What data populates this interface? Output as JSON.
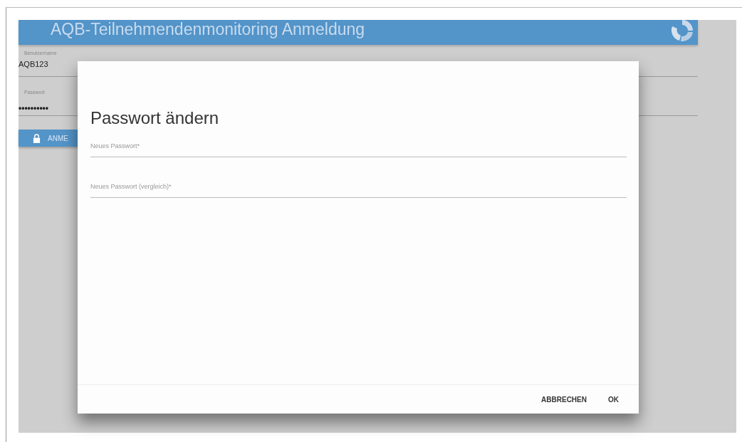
{
  "header": {
    "title": "AQB-Teilnehmendenmonitoring Anmeldung"
  },
  "login": {
    "fields": [
      {
        "label": "Benutzername",
        "value": "AQB123",
        "kind": "text"
      },
      {
        "label": "Passwort",
        "value": "••••••••••",
        "kind": "password"
      }
    ],
    "button": "ANME"
  },
  "dialog": {
    "title": "Passwort ändern",
    "fields": [
      {
        "label": "Neues Passwort*"
      },
      {
        "label": "Neues Passwort (vergleich)*"
      }
    ],
    "buttons": [
      "ABBRECHEN",
      "OK"
    ]
  }
}
